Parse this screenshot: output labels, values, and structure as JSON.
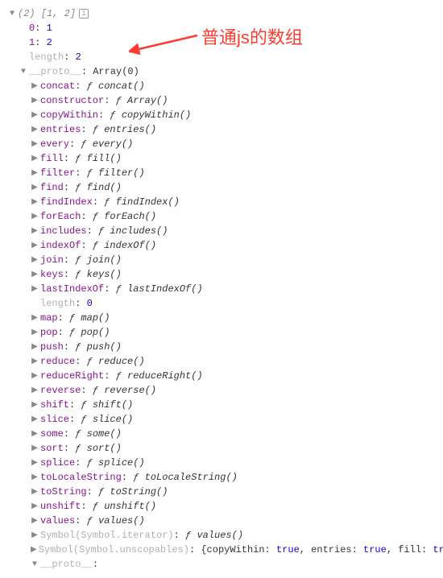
{
  "root": {
    "len": "(2)",
    "preview": "[1, 2]",
    "items": [
      {
        "k": "0",
        "v": "1"
      },
      {
        "k": "1",
        "v": "2"
      }
    ],
    "length_label": "length",
    "length_value": "2",
    "proto_label": "__proto__",
    "proto_value": "Array(0)"
  },
  "methods": [
    {
      "k": "concat",
      "v": "concat()"
    },
    {
      "k": "constructor",
      "v": "Array()"
    },
    {
      "k": "copyWithin",
      "v": "copyWithin()"
    },
    {
      "k": "entries",
      "v": "entries()"
    },
    {
      "k": "every",
      "v": "every()"
    },
    {
      "k": "fill",
      "v": "fill()"
    },
    {
      "k": "filter",
      "v": "filter()"
    },
    {
      "k": "find",
      "v": "find()"
    },
    {
      "k": "findIndex",
      "v": "findIndex()"
    },
    {
      "k": "forEach",
      "v": "forEach()"
    },
    {
      "k": "includes",
      "v": "includes()"
    },
    {
      "k": "indexOf",
      "v": "indexOf()"
    },
    {
      "k": "join",
      "v": "join()"
    },
    {
      "k": "keys",
      "v": "keys()"
    },
    {
      "k": "lastIndexOf",
      "v": "lastIndexOf()"
    }
  ],
  "proto_length_label": "length",
  "proto_length_value": "0",
  "methods2": [
    {
      "k": "map",
      "v": "map()"
    },
    {
      "k": "pop",
      "v": "pop()"
    },
    {
      "k": "push",
      "v": "push()"
    },
    {
      "k": "reduce",
      "v": "reduce()"
    },
    {
      "k": "reduceRight",
      "v": "reduceRight()"
    },
    {
      "k": "reverse",
      "v": "reverse()"
    },
    {
      "k": "shift",
      "v": "shift()"
    },
    {
      "k": "slice",
      "v": "slice()"
    },
    {
      "k": "some",
      "v": "some()"
    },
    {
      "k": "sort",
      "v": "sort()"
    },
    {
      "k": "splice",
      "v": "splice()"
    },
    {
      "k": "toLocaleString",
      "v": "toLocaleString()"
    },
    {
      "k": "toString",
      "v": "toString()"
    },
    {
      "k": "unshift",
      "v": "unshift()"
    },
    {
      "k": "values",
      "v": "values()"
    }
  ],
  "symbol_iter_key": "Symbol(Symbol.iterator)",
  "symbol_iter_val": "values()",
  "symbol_unsc_key": "Symbol(Symbol.unscopables)",
  "symbol_unsc_val": "{copyWithin: true, entries: true, fill: true, find: true, fin",
  "inner_proto_label": "__proto__",
  "annotation_text": "普通js的数组",
  "fchar": "ƒ",
  "info_glyph": "i"
}
